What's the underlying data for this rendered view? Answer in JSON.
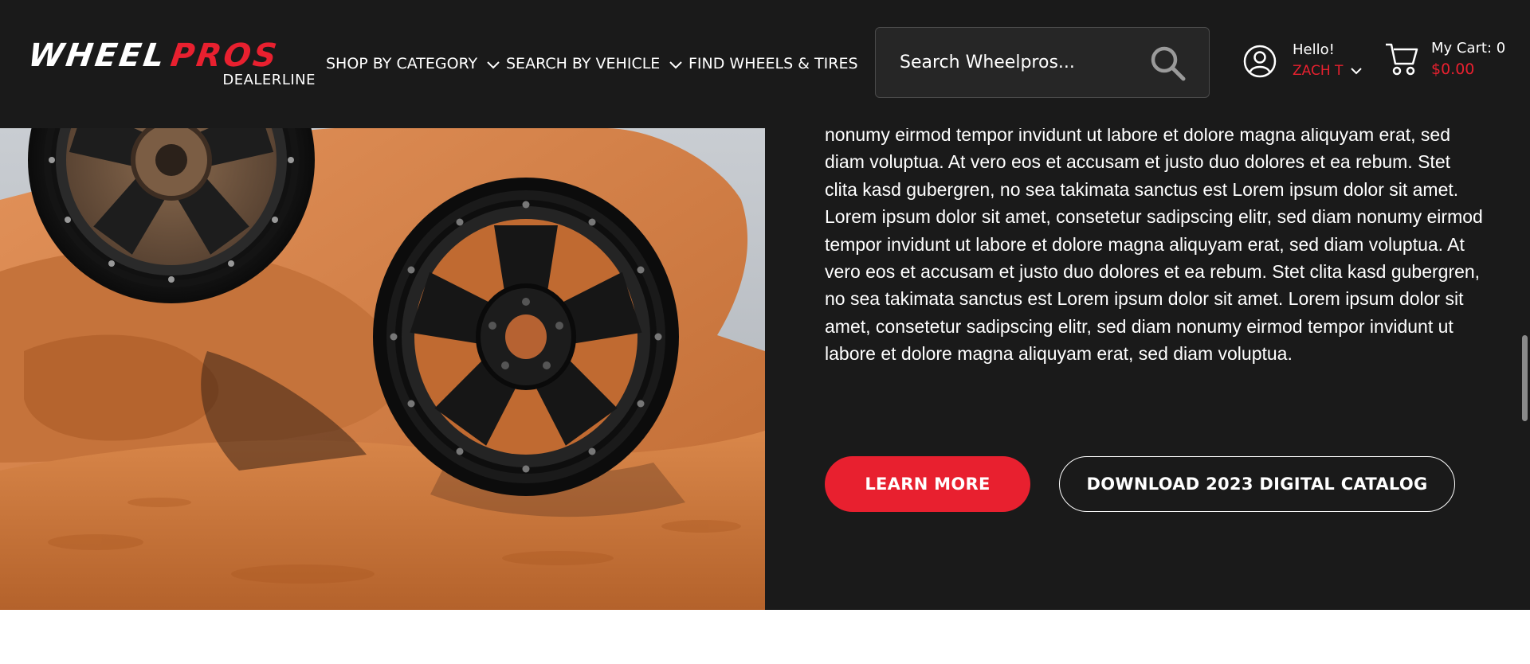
{
  "brand": {
    "logo_main_1": "WHEEL",
    "logo_main_2": "PROS",
    "logo_sub": "DEALERLINE",
    "accent_color": "#e8202f",
    "header_bg": "#1a1a1a"
  },
  "nav": {
    "items": [
      {
        "label": "SHOP BY CATEGORY",
        "icon": "chevron-down-icon"
      },
      {
        "label": "SEARCH BY VEHICLE",
        "icon": "chevron-down-icon"
      },
      {
        "label": "FIND WHEELS & TIRES"
      }
    ]
  },
  "search": {
    "placeholder": "Search Wheelpros...",
    "icon": "search-icon"
  },
  "account": {
    "greeting": "Hello!",
    "user_name": "ZACH T",
    "icon": "user-circle-icon"
  },
  "cart": {
    "label": "My Cart: 0",
    "total": "$0.00",
    "icon": "shopping-cart-icon"
  },
  "hero": {
    "body_text": "nonumy eirmod tempor invidunt ut labore et dolore magna aliquyam erat, sed diam voluptua. At vero eos et accusam et justo duo dolores et ea rebum. Stet clita kasd gubergren, no sea takimata sanctus est Lorem ipsum dolor sit amet. Lorem ipsum dolor sit amet, consetetur sadipscing elitr, sed diam nonumy eirmod tempor invidunt ut labore et dolore magna aliquyam erat, sed diam voluptua. At vero eos et accusam et justo duo dolores et ea rebum. Stet clita kasd gubergren, no sea takimata sanctus est Lorem ipsum dolor sit amet. Lorem ipsum dolor sit amet, consetetur sadipscing elitr, sed diam nonumy eirmod tempor invidunt ut labore et dolore magna aliquyam erat, sed diam voluptua.",
    "learn_more_label": "LEARN MORE",
    "catalog_label": "DOWNLOAD 2023 DIGITAL CATALOG"
  }
}
